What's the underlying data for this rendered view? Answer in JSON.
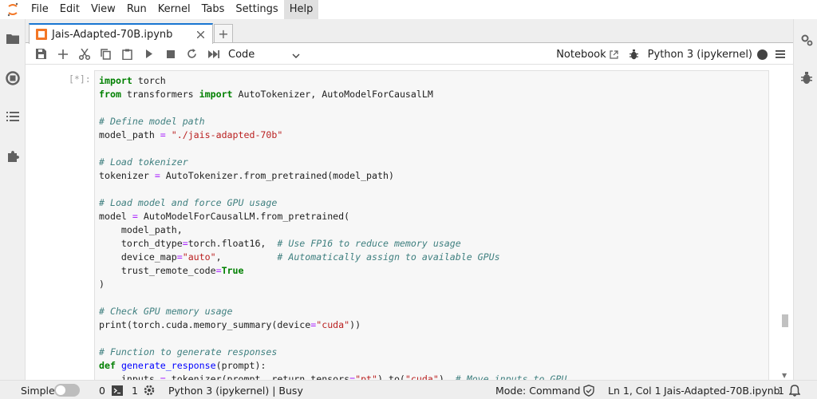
{
  "menubar": {
    "items": [
      "File",
      "Edit",
      "View",
      "Run",
      "Kernel",
      "Tabs",
      "Settings",
      "Help"
    ],
    "active": "Help"
  },
  "tab": {
    "title": "Jais-Adapted-70B.ipynb"
  },
  "toolbar": {
    "cell_type": "Code",
    "notebook_label": "Notebook",
    "kernel_name": "Python 3 (ipykernel)"
  },
  "cell": {
    "prompt": "[*]:"
  },
  "statusbar": {
    "mode_label": "Simple",
    "terminals_count": "0",
    "kernels_count": "1",
    "kernel_status": "Python 3 (ipykernel) | Busy",
    "mode": "Mode: Command",
    "position": "Ln 1, Col 1",
    "filename": "Jais-Adapted-70B.ipynb",
    "notifications": "1"
  },
  "colors": {
    "accent": "#1976d2",
    "logo": "#f37726"
  },
  "icons": {
    "left_sidebar": [
      "folder-icon",
      "running-icon",
      "toc-icon",
      "extension-icon"
    ],
    "right_sidebar": [
      "property-inspector-icon",
      "debugger-icon"
    ],
    "toolbar": [
      "save-icon",
      "insert-cell-icon",
      "cut-icon",
      "copy-icon",
      "paste-icon",
      "run-icon",
      "stop-icon",
      "restart-icon",
      "run-all-icon"
    ]
  }
}
